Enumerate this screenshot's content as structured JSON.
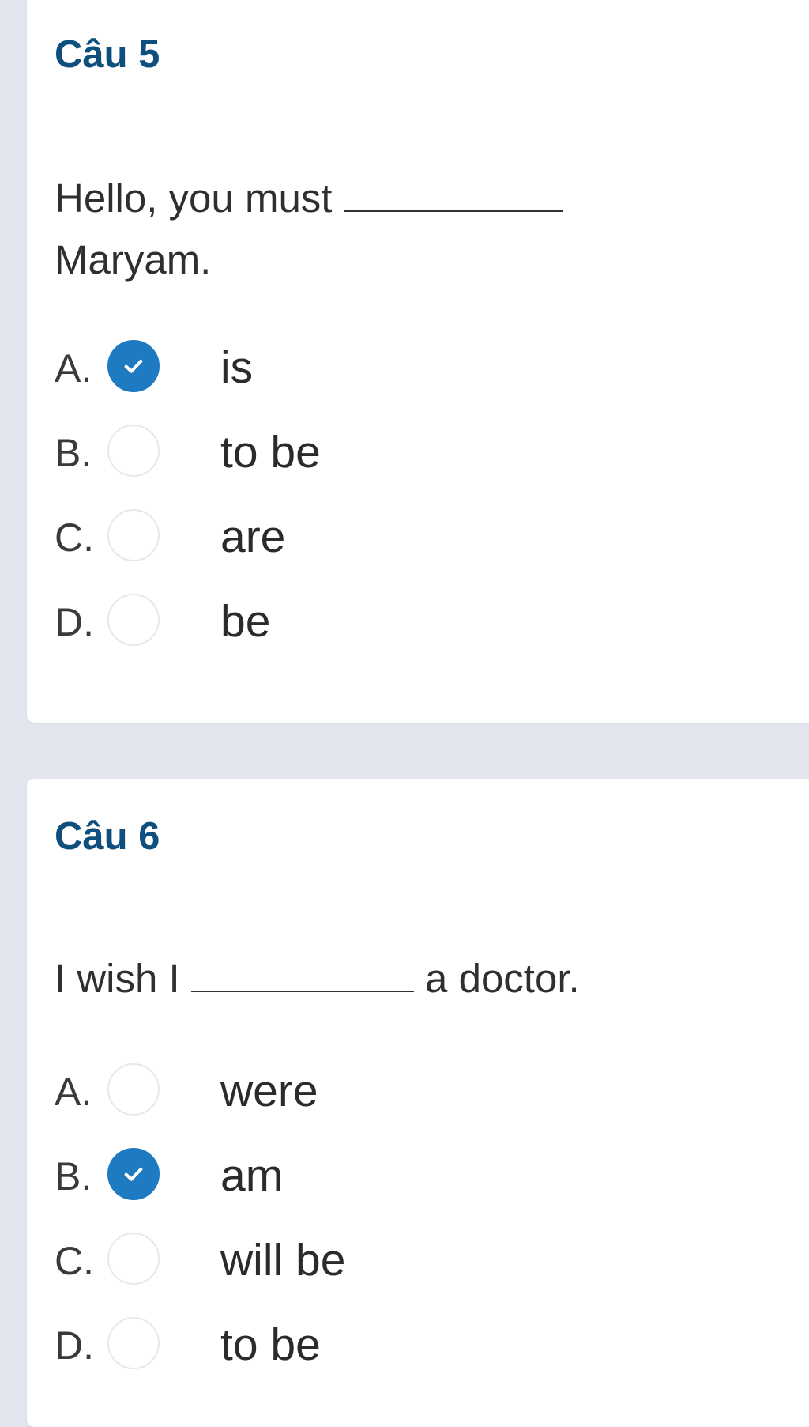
{
  "questions": [
    {
      "title": "Câu 5",
      "text_before": "Hello, you must",
      "text_after": "Maryam.",
      "options": [
        {
          "letter": "A.",
          "text": "is",
          "checked": true
        },
        {
          "letter": "B.",
          "text": "to be",
          "checked": false
        },
        {
          "letter": "C.",
          "text": "are",
          "checked": false
        },
        {
          "letter": "D.",
          "text": "be",
          "checked": false
        }
      ]
    },
    {
      "title": "Câu 6",
      "text_before": "I wish I",
      "text_after": "a doctor.",
      "options": [
        {
          "letter": "A.",
          "text": "were",
          "checked": false
        },
        {
          "letter": "B.",
          "text": "am",
          "checked": true
        },
        {
          "letter": "C.",
          "text": "will be",
          "checked": false
        },
        {
          "letter": "D.",
          "text": "to be",
          "checked": false
        }
      ]
    }
  ],
  "colors": {
    "page_background": "#e3e6ee",
    "card_background": "#ffffff",
    "title": "#0e4f7e",
    "radio_checked": "#1e7bc2",
    "radio_border": "#e8e8e8"
  },
  "icons": {
    "selected": "check-icon"
  }
}
